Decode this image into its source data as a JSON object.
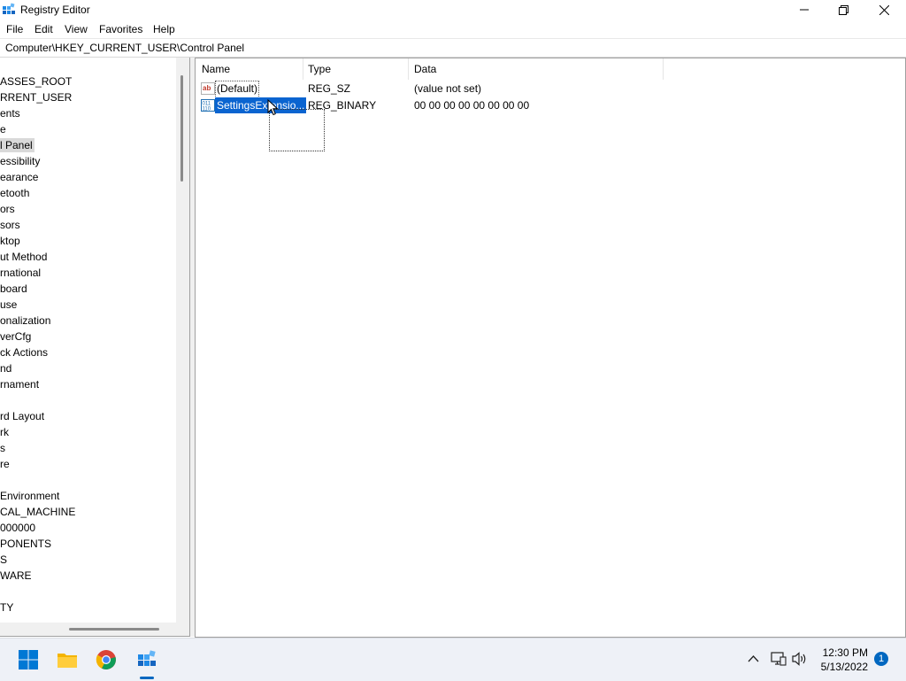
{
  "window": {
    "title": "Registry Editor",
    "icon": "registry-editor-icon",
    "controls": [
      "minimize",
      "maximize",
      "close"
    ]
  },
  "menu": {
    "items": [
      {
        "label": "File"
      },
      {
        "label": "Edit"
      },
      {
        "label": "View"
      },
      {
        "label": "Favorites"
      },
      {
        "label": "Help"
      }
    ]
  },
  "address": {
    "path": "Computer\\HKEY_CURRENT_USER\\Control Panel"
  },
  "tree": {
    "items": [
      {
        "label": "ASSES_ROOT"
      },
      {
        "label": "RRENT_USER"
      },
      {
        "label": "ents"
      },
      {
        "label": "e"
      },
      {
        "label": "l Panel",
        "selected": true
      },
      {
        "label": "essibility"
      },
      {
        "label": "earance"
      },
      {
        "label": "etooth"
      },
      {
        "label": "ors"
      },
      {
        "label": "sors"
      },
      {
        "label": "ktop"
      },
      {
        "label": "ut Method"
      },
      {
        "label": "rnational"
      },
      {
        "label": "board"
      },
      {
        "label": "use"
      },
      {
        "label": "onalization"
      },
      {
        "label": "verCfg"
      },
      {
        "label": "ck Actions"
      },
      {
        "label": "nd"
      },
      {
        "label": "rnament"
      },
      {
        "label": ""
      },
      {
        "label": "rd Layout"
      },
      {
        "label": "rk"
      },
      {
        "label": "s"
      },
      {
        "label": "re"
      },
      {
        "label": ""
      },
      {
        "label": " Environment"
      },
      {
        "label": "CAL_MACHINE"
      },
      {
        "label": "000000"
      },
      {
        "label": "PONENTS"
      },
      {
        "label": "S"
      },
      {
        "label": "WARE"
      },
      {
        "label": ""
      },
      {
        "label": "TY"
      }
    ]
  },
  "list": {
    "columns": {
      "name": "Name",
      "type": "Type",
      "data": "Data"
    },
    "rows": [
      {
        "name": "(Default)",
        "type": "REG_SZ",
        "data": "(value not set)",
        "icon": "string-value-icon",
        "state": "focused"
      },
      {
        "name": "SettingsExtensio...",
        "type": "REG_BINARY",
        "data": "00 00 00 00 00 00 00 00",
        "icon": "binary-value-icon",
        "state": "selected"
      }
    ]
  },
  "taskbar": {
    "pinned": [
      "start-icon",
      "file-explorer-icon",
      "chrome-icon",
      "registry-editor-icon"
    ],
    "tray": [
      "chevron-up-icon",
      "network-icon",
      "volume-icon"
    ],
    "time": "12:30 PM",
    "date": "5/13/2022",
    "notification_count": "1"
  },
  "colors": {
    "selection": "#0a64d0",
    "tree_selection": "#d9d9d9",
    "taskbar": "#eef1f7",
    "accent": "#0067c0"
  }
}
